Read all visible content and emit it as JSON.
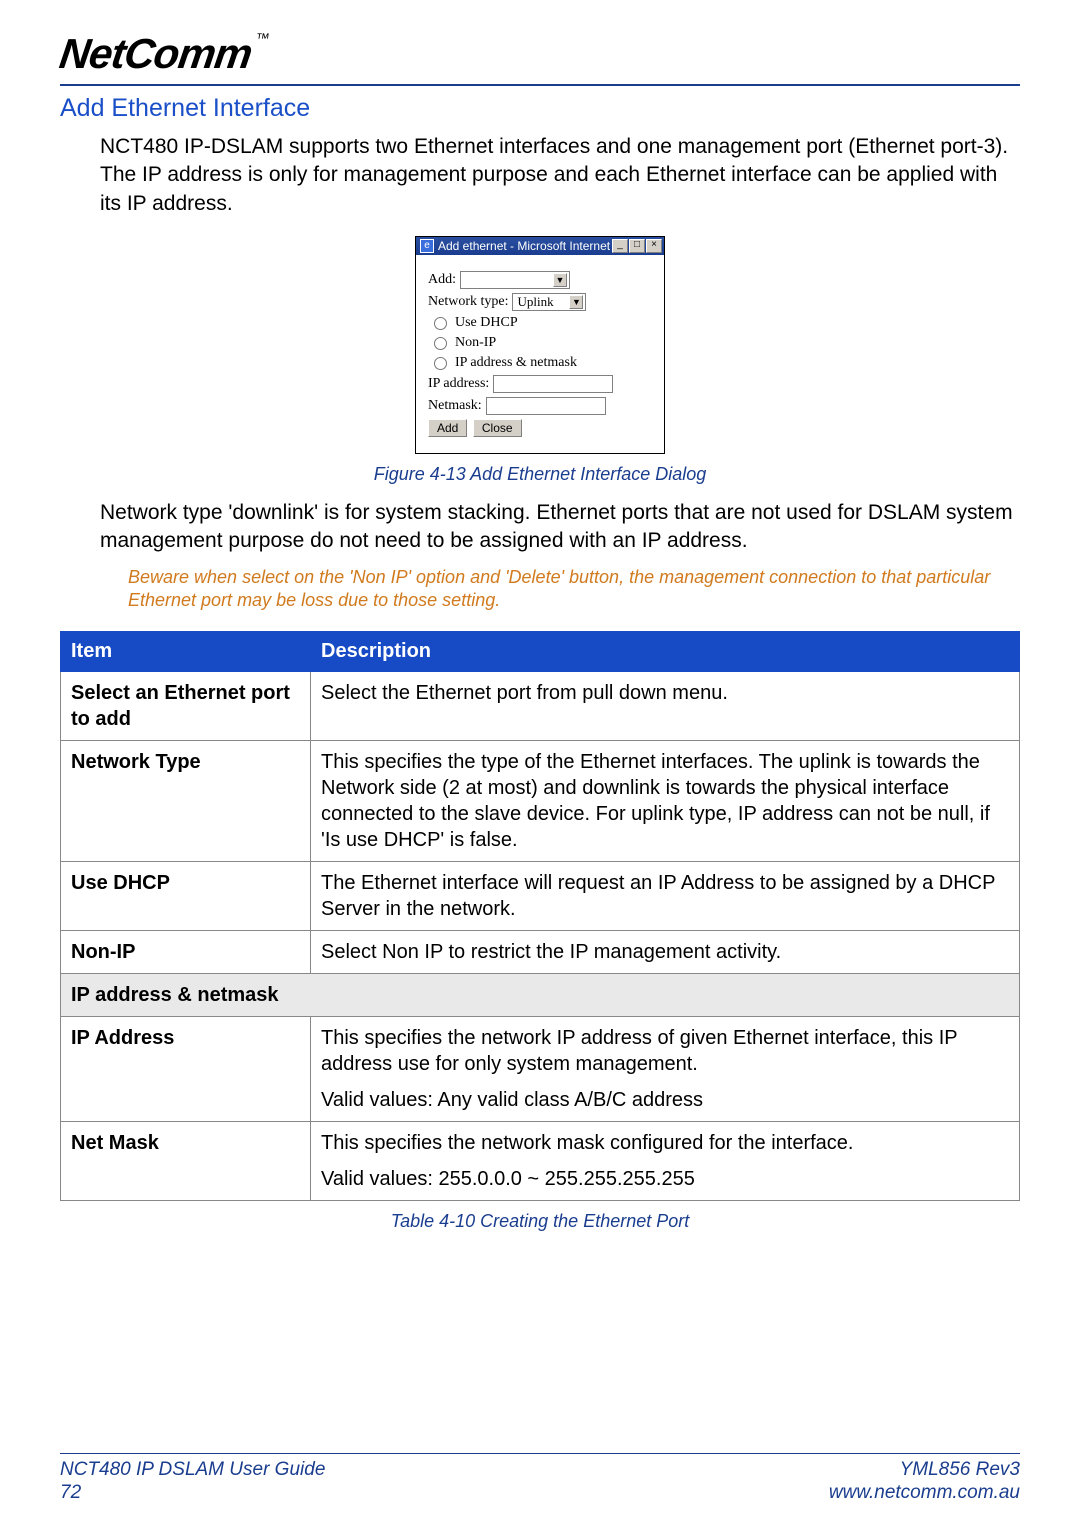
{
  "header": {
    "brand": "NetComm",
    "tm": "™"
  },
  "section": {
    "title": "Add Ethernet Interface",
    "intro": "NCT480 IP-DSLAM supports two Ethernet interfaces and one management port (Ethernet port-3). The IP address is only for management purpose and each Ethernet interface can be applied with its IP address.",
    "figure_caption": "Figure 4-13 Add Ethernet Interface Dialog",
    "after_figure": "Network type 'downlink' is for system stacking. Ethernet ports that are not used for DSLAM system management purpose do not need to be assigned with an IP address.",
    "warning": "Beware when select on the 'Non IP' option and 'Delete' button, the management connection to that particular Ethernet port may be loss due to those setting.",
    "table_caption": "Table 4-10 Creating the Ethernet Port"
  },
  "dialog": {
    "title": "Add ethernet - Microsoft Internet",
    "min": "_",
    "max": "□",
    "close": "×",
    "add_label": "Add:",
    "nettype_label": "Network type:",
    "nettype_value": "Uplink",
    "opt_dhcp": "Use DHCP",
    "opt_nonip": "Non-IP",
    "opt_ipnm": "IP address & netmask",
    "ip_label": "IP address:",
    "nm_label": "Netmask:",
    "btn_add": "Add",
    "btn_close": "Close"
  },
  "table": {
    "h_item": "Item",
    "h_desc": "Description",
    "rows": {
      "select_port": {
        "label": "Select an Ethernet port to add",
        "desc": "Select the Ethernet port from pull down menu."
      },
      "network_type": {
        "label": "Network Type",
        "desc": "This specifies the type of the Ethernet interfaces. The uplink is towards the Network side (2 at most) and downlink is towards the physical interface connected to the slave device. For uplink type, IP address can not be null, if 'Is use DHCP' is false."
      },
      "use_dhcp": {
        "label": "Use DHCP",
        "desc": "The Ethernet interface will request an IP Address to be assigned by a DHCP Server in the network."
      },
      "non_ip": {
        "label": "Non-IP",
        "desc": "Select Non IP to restrict the IP management activity."
      },
      "ipnm_sub": "IP address & netmask",
      "ip_addr": {
        "label": "IP Address",
        "desc": "This specifies the network IP address of given Ethernet interface, this IP address use for only system management.",
        "valid": "Valid values: Any valid class A/B/C address"
      },
      "net_mask": {
        "label": "Net Mask",
        "desc": "This specifies the network mask configured for the interface.",
        "valid": "Valid values: 255.0.0.0 ~ 255.255.255.255"
      }
    }
  },
  "footer": {
    "guide": "NCT480 IP DSLAM User Guide",
    "page": "72",
    "rev": "YML856 Rev3",
    "url": "www.netcomm.com.au"
  }
}
